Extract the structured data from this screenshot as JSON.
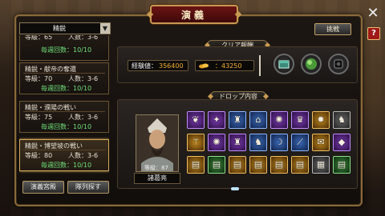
{
  "header": {
    "title": "演義",
    "close": "✕",
    "help": "?"
  },
  "stage_select": {
    "dropdown_label": "精鋭",
    "dropdown_arrow": "▼",
    "stages": [
      {
        "name": "",
        "level": "等級：65",
        "players": "人数：3-6",
        "weekly": "毎週回数：10/10",
        "selected": false
      },
      {
        "name": "精鋭・献帝の奪還",
        "level": "等級：70",
        "players": "人数：3-6",
        "weekly": "毎週回数：10/10",
        "selected": false
      },
      {
        "name": "精鋭・濮陽の戦い",
        "level": "等級：75",
        "players": "人数：3-6",
        "weekly": "毎週回数：10/10",
        "selected": false
      },
      {
        "name": "精鋭・博望坡の戦い",
        "level": "等級：80",
        "players": "人数：3-6",
        "weekly": "毎週回数：10/10",
        "selected": true
      }
    ],
    "buttons": {
      "invite": "演義宮殿",
      "search": "隊列探す"
    }
  },
  "challenge_label": "挑戦",
  "clear_reward": {
    "header": "クリア報酬",
    "exp_label": "経験値：",
    "exp_value": "356400",
    "gold_value": "：43250",
    "icons": [
      "chest-icon",
      "green-orb-icon",
      "black-orb-icon"
    ]
  },
  "drop": {
    "header": "ドロップ内容",
    "general": {
      "level": "等級：87",
      "name": "諸葛亮"
    },
    "items": [
      {
        "rarity": "purple",
        "icon": "wing-icon",
        "glyph": "❦"
      },
      {
        "rarity": "purple",
        "icon": "dragon-icon",
        "glyph": "✦"
      },
      {
        "rarity": "blue",
        "icon": "armor-icon",
        "glyph": "♜"
      },
      {
        "rarity": "blue",
        "icon": "shoe-icon",
        "glyph": "⌂"
      },
      {
        "rarity": "purple",
        "icon": "fire-orb-icon",
        "glyph": "✺"
      },
      {
        "rarity": "purple",
        "icon": "helmet-icon",
        "glyph": "♛"
      },
      {
        "rarity": "gold",
        "icon": "flame-icon",
        "glyph": "✹"
      },
      {
        "rarity": "gray",
        "icon": "cape-icon",
        "glyph": "♞"
      },
      {
        "rarity": "gold",
        "icon": "trident-icon",
        "glyph": "⚚"
      },
      {
        "rarity": "purple",
        "icon": "fire-icon",
        "glyph": "✺"
      },
      {
        "rarity": "purple",
        "icon": "armor-icon",
        "glyph": "♜"
      },
      {
        "rarity": "blue",
        "icon": "horse-icon",
        "glyph": "♞"
      },
      {
        "rarity": "blue",
        "icon": "bow-icon",
        "glyph": "☽"
      },
      {
        "rarity": "blue",
        "icon": "spear-icon",
        "glyph": "⟋"
      },
      {
        "rarity": "gold",
        "icon": "scroll-icon",
        "glyph": "✉"
      },
      {
        "rarity": "purple",
        "icon": "gem-icon",
        "glyph": "◆"
      },
      {
        "rarity": "gold",
        "icon": "book-icon",
        "glyph": "▤"
      },
      {
        "rarity": "green",
        "icon": "book-icon",
        "glyph": "▤"
      },
      {
        "rarity": "gold",
        "icon": "gold-book-icon",
        "glyph": "▤"
      },
      {
        "rarity": "gold",
        "icon": "gold-book-icon",
        "glyph": "▤"
      },
      {
        "rarity": "gold",
        "icon": "gold-book-icon",
        "glyph": "▤"
      },
      {
        "rarity": "gold",
        "icon": "gold-book-icon",
        "glyph": "▤"
      },
      {
        "rarity": "gray",
        "icon": "plate-icon",
        "glyph": "▦"
      },
      {
        "rarity": "green",
        "icon": "manual-icon",
        "glyph": "▤"
      }
    ]
  }
}
